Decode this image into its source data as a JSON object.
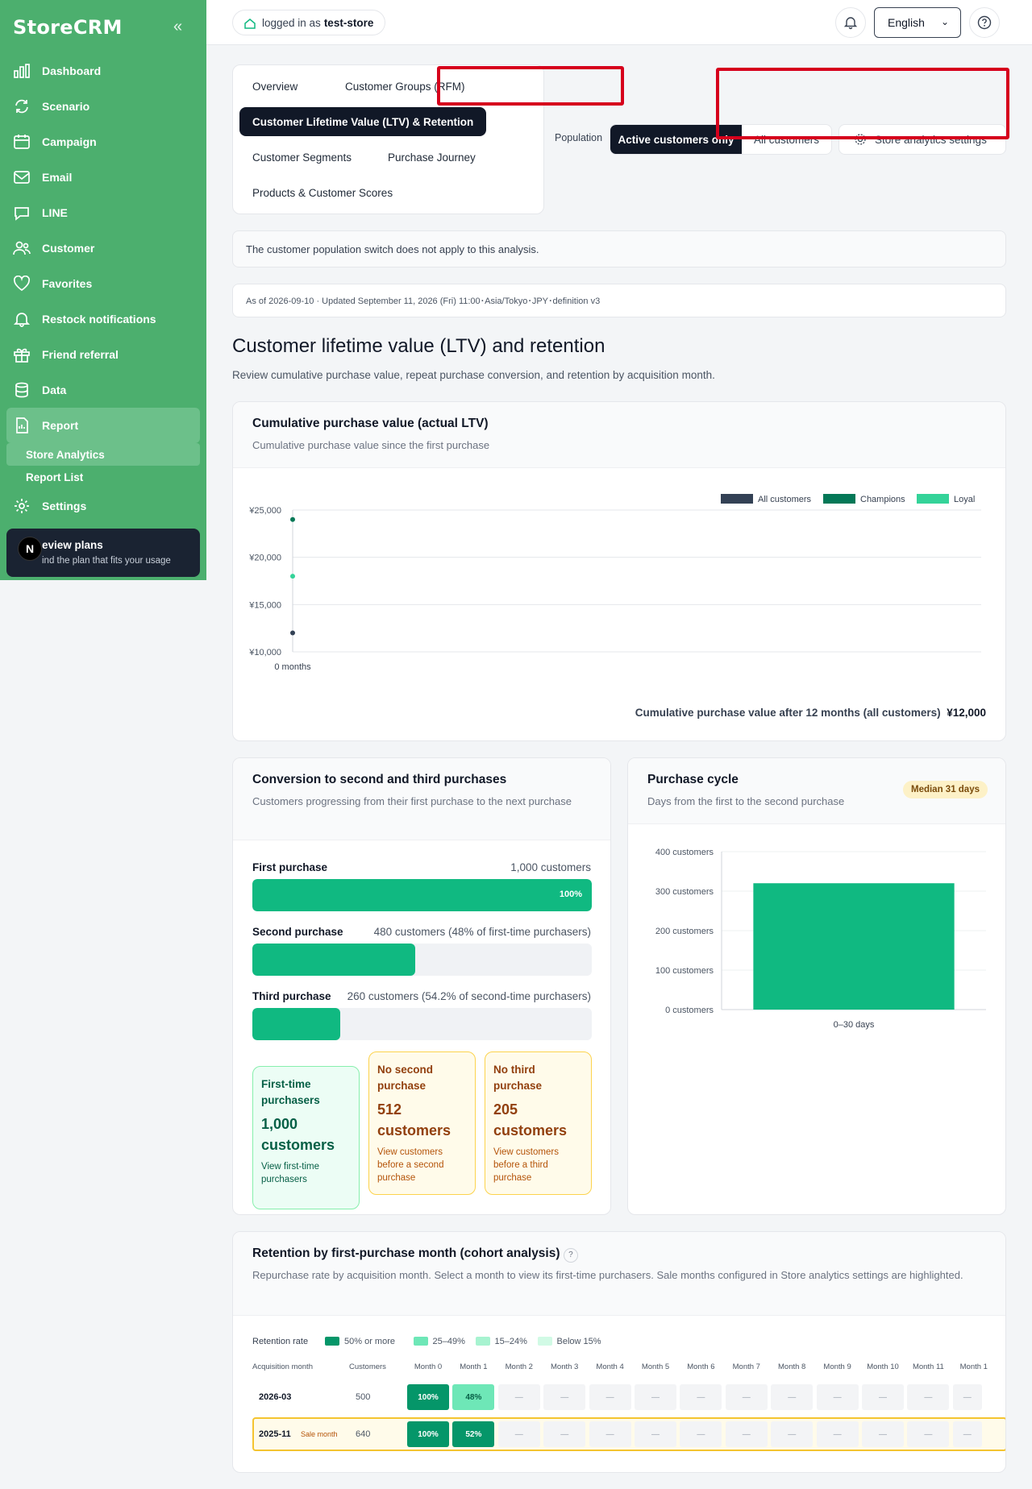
{
  "app": {
    "brand": "StoreCRM",
    "collapse_icon": "chevrons-left-icon"
  },
  "sidebar": {
    "items": [
      {
        "label": "Dashboard",
        "icon": "bar-chart-icon"
      },
      {
        "label": "Scenario",
        "icon": "refresh-icon"
      },
      {
        "label": "Campaign",
        "icon": "calendar-icon"
      },
      {
        "label": "Email",
        "icon": "mail-icon"
      },
      {
        "label": "LINE",
        "icon": "chat-icon"
      },
      {
        "label": "Customer",
        "icon": "users-icon"
      },
      {
        "label": "Favorites",
        "icon": "heart-icon"
      },
      {
        "label": "Restock notifications",
        "icon": "bell-icon"
      },
      {
        "label": "Friend referral",
        "icon": "gift-icon"
      },
      {
        "label": "Data",
        "icon": "database-icon"
      },
      {
        "label": "Report",
        "icon": "report-icon",
        "active": true
      }
    ],
    "sub_items": [
      {
        "label": "Store Analytics",
        "active": true
      },
      {
        "label": "Report List"
      }
    ],
    "settings": {
      "label": "Settings",
      "icon": "gear-icon"
    },
    "plan": {
      "badge": "N",
      "title": "eview plans",
      "subtitle": "ind the plan that fits your usage"
    }
  },
  "topbar": {
    "logged_in_prefix": "logged in as",
    "store": "test-store",
    "language": "English"
  },
  "tabs": [
    "Overview",
    "Customer Groups (RFM)",
    "Customer Lifetime Value (LTV) & Retention",
    "Customer Segments",
    "Purchase Journey",
    "Products & Customer Scores"
  ],
  "population": {
    "label": "Population",
    "active": "Active customers only",
    "inactive": "All customers",
    "settings_button": "Store analytics settings"
  },
  "notice": "The customer population switch does not apply to this analysis.",
  "as_of": "As of 2026-09-10 · Updated September 11, 2026 (Fri) 11:00･Asia/Tokyo･JPY･definition v3",
  "page": {
    "title": "Customer lifetime value (LTV) and retention",
    "lead": "Review cumulative purchase value, repeat purchase conversion, and retention by acquisition month."
  },
  "ltv": {
    "title": "Cumulative purchase value (actual LTV)",
    "subtitle": "Cumulative purchase value since the first purchase",
    "footer_label": "Cumulative purchase value after 12 months (all customers)",
    "footer_value": "¥12,000"
  },
  "conversion": {
    "title": "Conversion to second and third purchases",
    "subtitle": "Customers progressing from their first purchase to the next purchase",
    "steps": [
      {
        "label": "First purchase",
        "value": "1,000 customers",
        "pct": "100%",
        "fill": 1.0
      },
      {
        "label": "Second purchase",
        "value": "480 customers (48% of first-time purchasers)",
        "fill": 0.48
      },
      {
        "label": "Third purchase",
        "value": "260 customers (54.2% of second-time purchasers)",
        "fill": 0.26
      }
    ],
    "cards": [
      {
        "title": "First-time purchasers",
        "count": "1,000 customers",
        "link": "View first-time purchasers"
      },
      {
        "title": "No second purchase",
        "count": "512 customers",
        "link": "View customers before a second purchase"
      },
      {
        "title": "No third purchase",
        "count": "205 customers",
        "link": "View customers before a third purchase"
      }
    ]
  },
  "cycle": {
    "title": "Purchase cycle",
    "subtitle": "Days from the first to the second purchase",
    "median": "Median 31 days"
  },
  "cohort": {
    "title": "Retention by first-purchase month (cohort analysis)",
    "help": "?",
    "subtitle": "Repurchase rate by acquisition month. Select a month to view its first-time purchasers. Sale months configured in Store analytics settings are highlighted.",
    "legend_label": "Retention rate",
    "legend": [
      {
        "label": "50% or more",
        "color": "#059669"
      },
      {
        "label": "25–49%",
        "color": "#6ee7b7"
      },
      {
        "label": "15–24%",
        "color": "#a7f3d0"
      },
      {
        "label": "Below 15%",
        "color": "#d1fae5"
      }
    ],
    "col_month": "Acquisition month",
    "col_customers": "Customers",
    "months": [
      "Month 0",
      "Month 1",
      "Month 2",
      "Month 3",
      "Month 4",
      "Month 5",
      "Month 6",
      "Month 7",
      "Month 8",
      "Month 9",
      "Month 10",
      "Month 11",
      "Month 1"
    ],
    "rows": [
      {
        "month": "2026-03",
        "customers": "500",
        "cells": [
          "100%",
          "48%",
          "—",
          "—",
          "—",
          "—",
          "—",
          "—",
          "—",
          "—",
          "—",
          "—",
          "—"
        ]
      },
      {
        "month": "2025-11",
        "sale": "Sale month",
        "customers": "640",
        "cells": [
          "100%",
          "52%",
          "—",
          "—",
          "—",
          "—",
          "—",
          "—",
          "—",
          "—",
          "—",
          "—",
          "—"
        ]
      }
    ]
  },
  "chart_data": [
    {
      "type": "scatter",
      "title": "Cumulative purchase value (actual LTV)",
      "x_labels": [
        "0 months"
      ],
      "ylim": [
        10000,
        25000
      ],
      "y_ticks": [
        "¥10,000",
        "¥15,000",
        "¥20,000",
        "¥25,000"
      ],
      "grid": true,
      "legend_position": "top-right",
      "series": [
        {
          "name": "All customers",
          "color": "#334155",
          "points": [
            {
              "x": 0,
              "y": 12000
            }
          ]
        },
        {
          "name": "Champions",
          "color": "#047857",
          "points": [
            {
              "x": 0,
              "y": 24000
            }
          ]
        },
        {
          "name": "Loyal",
          "color": "#34d399",
          "points": [
            {
              "x": 0,
              "y": 18000
            }
          ]
        }
      ]
    },
    {
      "type": "bar",
      "title": "Purchase cycle",
      "categories": [
        "0–30 days"
      ],
      "values": [
        320
      ],
      "ylim": [
        0,
        400
      ],
      "y_ticks": [
        "0 customers",
        "100 customers",
        "200 customers",
        "300 customers",
        "400 customers"
      ],
      "color": "#10b981"
    }
  ]
}
